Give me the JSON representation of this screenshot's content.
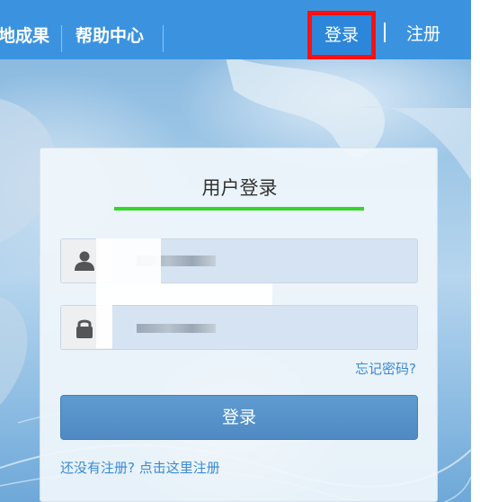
{
  "topnav": {
    "items": [
      {
        "label": "地成果"
      },
      {
        "label": "帮助中心"
      }
    ],
    "login_label": "登录",
    "divider": "|",
    "register_label": "注册"
  },
  "login_form": {
    "title": "用户登录",
    "username": {
      "icon": "user-icon",
      "value": ""
    },
    "password": {
      "icon": "lock-icon",
      "value": ""
    },
    "forgot_label": "忘记密码?",
    "submit_label": "登录",
    "register_prompt": "还没有注册? 点击这里注册"
  },
  "colors": {
    "nav_bar": "#3b93e0",
    "highlight_border": "#ff1010",
    "title_underline": "#35d52c",
    "button": "#5595cc",
    "link": "#3a8ad6"
  }
}
